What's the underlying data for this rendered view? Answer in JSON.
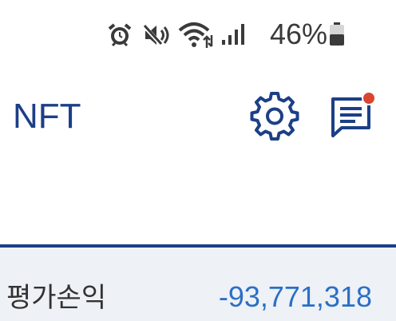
{
  "status_bar": {
    "battery_percent": "46%",
    "icons": [
      "alarm-icon",
      "mute-icon",
      "wifi-icon",
      "signal-icon",
      "battery-icon"
    ]
  },
  "app_bar": {
    "title": "NFT",
    "icons": [
      "gear-icon",
      "chat-notification-icon"
    ],
    "notification_color": "#d9452f",
    "accent_color": "#1c3f87"
  },
  "summary": {
    "label": "평가손익",
    "value": "-93,771,318",
    "value_color": "#2a6fc7"
  }
}
